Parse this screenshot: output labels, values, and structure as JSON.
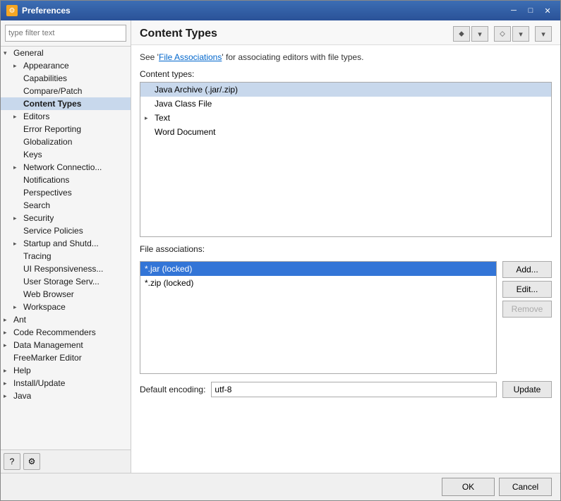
{
  "window": {
    "title": "Preferences",
    "icon": "⚙"
  },
  "filter": {
    "placeholder": "type filter text"
  },
  "tree": {
    "items": [
      {
        "id": "general",
        "label": "General",
        "level": 0,
        "hasArrow": true,
        "expanded": true,
        "selected": false
      },
      {
        "id": "appearance",
        "label": "Appearance",
        "level": 1,
        "hasArrow": true,
        "expanded": false,
        "selected": false
      },
      {
        "id": "capabilities",
        "label": "Capabilities",
        "level": 1,
        "hasArrow": false,
        "expanded": false,
        "selected": false
      },
      {
        "id": "compare-patch",
        "label": "Compare/Patch",
        "level": 1,
        "hasArrow": false,
        "expanded": false,
        "selected": false
      },
      {
        "id": "content-types",
        "label": "Content Types",
        "level": 1,
        "hasArrow": false,
        "expanded": false,
        "selected": true
      },
      {
        "id": "editors",
        "label": "Editors",
        "level": 1,
        "hasArrow": true,
        "expanded": false,
        "selected": false
      },
      {
        "id": "error-reporting",
        "label": "Error Reporting",
        "level": 1,
        "hasArrow": false,
        "expanded": false,
        "selected": false
      },
      {
        "id": "globalization",
        "label": "Globalization",
        "level": 1,
        "hasArrow": false,
        "expanded": false,
        "selected": false
      },
      {
        "id": "keys",
        "label": "Keys",
        "level": 1,
        "hasArrow": false,
        "expanded": false,
        "selected": false
      },
      {
        "id": "network-connections",
        "label": "Network Connectio...",
        "level": 1,
        "hasArrow": true,
        "expanded": false,
        "selected": false
      },
      {
        "id": "notifications",
        "label": "Notifications",
        "level": 1,
        "hasArrow": false,
        "expanded": false,
        "selected": false
      },
      {
        "id": "perspectives",
        "label": "Perspectives",
        "level": 1,
        "hasArrow": false,
        "expanded": false,
        "selected": false
      },
      {
        "id": "search",
        "label": "Search",
        "level": 1,
        "hasArrow": false,
        "expanded": false,
        "selected": false
      },
      {
        "id": "security",
        "label": "Security",
        "level": 1,
        "hasArrow": true,
        "expanded": false,
        "selected": false
      },
      {
        "id": "service-policies",
        "label": "Service Policies",
        "level": 1,
        "hasArrow": false,
        "expanded": false,
        "selected": false
      },
      {
        "id": "startup-shutdown",
        "label": "Startup and Shutd...",
        "level": 1,
        "hasArrow": true,
        "expanded": false,
        "selected": false
      },
      {
        "id": "tracing",
        "label": "Tracing",
        "level": 1,
        "hasArrow": false,
        "expanded": false,
        "selected": false
      },
      {
        "id": "ui-responsiveness",
        "label": "UI Responsiveness...",
        "level": 1,
        "hasArrow": false,
        "expanded": false,
        "selected": false
      },
      {
        "id": "user-storage",
        "label": "User Storage Serv...",
        "level": 1,
        "hasArrow": false,
        "expanded": false,
        "selected": false
      },
      {
        "id": "web-browser",
        "label": "Web Browser",
        "level": 1,
        "hasArrow": false,
        "expanded": false,
        "selected": false
      },
      {
        "id": "workspace",
        "label": "Workspace",
        "level": 1,
        "hasArrow": true,
        "expanded": false,
        "selected": false
      },
      {
        "id": "ant",
        "label": "Ant",
        "level": 0,
        "hasArrow": true,
        "expanded": false,
        "selected": false
      },
      {
        "id": "code-recommenders",
        "label": "Code Recommenders",
        "level": 0,
        "hasArrow": true,
        "expanded": false,
        "selected": false
      },
      {
        "id": "data-management",
        "label": "Data Management",
        "level": 0,
        "hasArrow": true,
        "expanded": false,
        "selected": false
      },
      {
        "id": "freemarker-editor",
        "label": "FreeMarker Editor",
        "level": 0,
        "hasArrow": false,
        "expanded": false,
        "selected": false
      },
      {
        "id": "help",
        "label": "Help",
        "level": 0,
        "hasArrow": true,
        "expanded": false,
        "selected": false
      },
      {
        "id": "install-update",
        "label": "Install/Update",
        "level": 0,
        "hasArrow": true,
        "expanded": false,
        "selected": false
      },
      {
        "id": "java",
        "label": "Java",
        "level": 0,
        "hasArrow": true,
        "expanded": false,
        "selected": false
      }
    ]
  },
  "right": {
    "title": "Content Types",
    "toolbar": {
      "back_label": "◁",
      "forward_label": "▷",
      "menu_label": "▾"
    },
    "info_text_pre": "See '",
    "info_link": "File Associations",
    "info_text_post": "' for associating editors with file types.",
    "content_types_label": "Content types:",
    "content_types": [
      {
        "id": "jar-zip",
        "label": "Java Archive (.jar/.zip)",
        "hasArrow": false,
        "selected": true
      },
      {
        "id": "java-class",
        "label": "Java Class File",
        "hasArrow": false,
        "selected": false
      },
      {
        "id": "text",
        "label": "Text",
        "hasArrow": true,
        "selected": false
      },
      {
        "id": "word-doc",
        "label": "Word Document",
        "hasArrow": false,
        "selected": false
      }
    ],
    "file_associations_label": "File associations:",
    "file_associations": [
      {
        "id": "jar",
        "label": "*.jar (locked)",
        "selected": true
      },
      {
        "id": "zip",
        "label": "*.zip (locked)",
        "selected": false
      }
    ],
    "buttons": {
      "add": "Add...",
      "edit": "Edit...",
      "remove": "Remove"
    },
    "encoding_label": "Default encoding:",
    "encoding_value": "utf-8",
    "update_label": "Update"
  },
  "bottom": {
    "ok_label": "OK",
    "cancel_label": "Cancel"
  }
}
